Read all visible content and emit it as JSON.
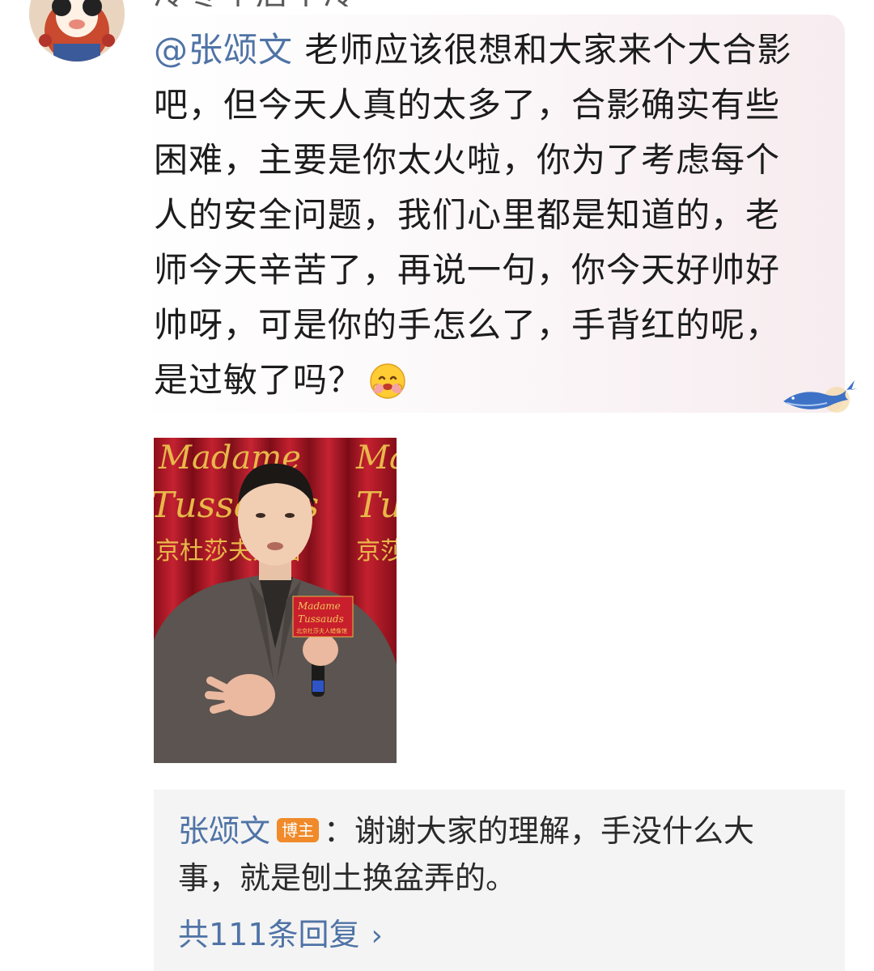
{
  "header": {
    "username_partial": "冷冬午后不冷"
  },
  "comment": {
    "mention": "@张颂文",
    "body": " 老师应该很想和大家来个大合影吧，但今天人真的太多了，合影确实有些困难，主要是你太火啦，你为了考虑每个人的安全问题，我们心里都是知道的，老师今天辛苦了，再说一句，你今天好帅好帅呀，可是你的手怎么了，手背红的呢，是过敏了吗？",
    "emoji": "hugging-face-emoji"
  },
  "photo": {
    "backdrop_text_1": "Madame",
    "backdrop_text_2": "Tussauds",
    "backdrop_cn": "京杜莎夫人蜡",
    "backdrop_right_1": "Ma",
    "backdrop_right_2": "Tus",
    "backdrop_right_cn": "京莎",
    "mic_flag_1": "Madame",
    "mic_flag_2": "Tussauds",
    "mic_flag_cn": "北京杜莎夫人蜡像馆"
  },
  "reply": {
    "author": "张颂文",
    "badge": "博主",
    "text": "：谢谢大家的理解，手没什么大事，就是刨土换盆弄的。",
    "more_label": "共111条回复"
  },
  "colors": {
    "link": "#4f73a6",
    "text": "#1c1c1c",
    "badge": "#f08a2a",
    "reply_bg": "#f4f4f4"
  }
}
